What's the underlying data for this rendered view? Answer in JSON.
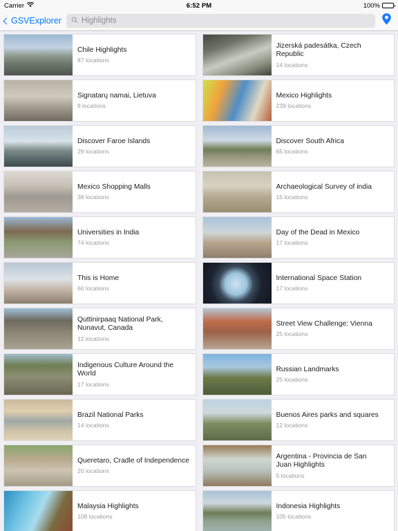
{
  "status_bar": {
    "carrier": "Carrier",
    "wifi_icon": "wifi-icon",
    "time": "6:52 PM",
    "battery_percent": "100%",
    "battery_icon": "battery-icon"
  },
  "nav_bar": {
    "back_icon": "chevron-left-icon",
    "back_label": "GSVExplorer",
    "search_icon": "search-icon",
    "search_value": "",
    "search_placeholder": "Highlights",
    "pin_icon": "map-pin-icon",
    "accent_color": "#007aff"
  },
  "collections": [
    {
      "title": "Chile Highlights",
      "locations": "87 locations",
      "thumb": "mountain-lake-photo"
    },
    {
      "title": "Jizerská padesátka, Czech Republic",
      "locations": "14 locations",
      "thumb": "snowy-forest-photo"
    },
    {
      "title": "Signatarų namai, Lietuva",
      "locations": "8 locations",
      "thumb": "historic-building-photo"
    },
    {
      "title": "Mexico Highlights",
      "locations": "239 locations",
      "thumb": "colorful-mural-photo"
    },
    {
      "title": "Discover Faroe Islands",
      "locations": "29 locations",
      "thumb": "coastal-cliffs-photo"
    },
    {
      "title": "Discover South Africa",
      "locations": "65 locations",
      "thumb": "savanna-river-photo"
    },
    {
      "title": "Mexico Shopping Malls",
      "locations": "38 locations",
      "thumb": "mall-interior-photo"
    },
    {
      "title": "Archaeological Survey of india",
      "locations": "15 locations",
      "thumb": "domed-monument-photo"
    },
    {
      "title": "Universities in India",
      "locations": "74 locations",
      "thumb": "campus-building-photo"
    },
    {
      "title": "Day of the Dead in Mexico",
      "locations": "17 locations",
      "thumb": "city-plaza-festival-photo"
    },
    {
      "title": "This is Home",
      "locations": "60 locations",
      "thumb": "snow-house-photo"
    },
    {
      "title": "International Space Station",
      "locations": "17 locations",
      "thumb": "space-station-cupola-photo"
    },
    {
      "title": "Quttinirpaaq National Park,\nNunavut, Canada",
      "locations": "12 locations",
      "thumb": "arctic-tundra-photo"
    },
    {
      "title": "Street View Challenge: Vienna",
      "locations": "25 locations",
      "thumb": "vienna-rooftops-photo"
    },
    {
      "title": "Indigenous Culture Around the World",
      "locations": "17 locations",
      "thumb": "village-people-photo"
    },
    {
      "title": "Russian Landmarks",
      "locations": "25 locations",
      "thumb": "kremlin-park-photo"
    },
    {
      "title": "Brazil National Parks",
      "locations": "14 locations",
      "thumb": "beach-sunset-photo"
    },
    {
      "title": "Buenos Aires parks and squares",
      "locations": "12 locations",
      "thumb": "city-park-photo"
    },
    {
      "title": "Queretaro, Cradle of Independence",
      "locations": "20 locations",
      "thumb": "plaza-fountain-photo"
    },
    {
      "title": "Argentina - Provincia de San\nJuan  Highlights",
      "locations": "5 locations",
      "thumb": "museum-room-photo"
    },
    {
      "title": "Malaysia Highlights",
      "locations": "108 locations",
      "thumb": "coral-reef-photo"
    },
    {
      "title": "Indonesia Highlights",
      "locations": "105 locations",
      "thumb": "island-lagoon-photo"
    }
  ]
}
